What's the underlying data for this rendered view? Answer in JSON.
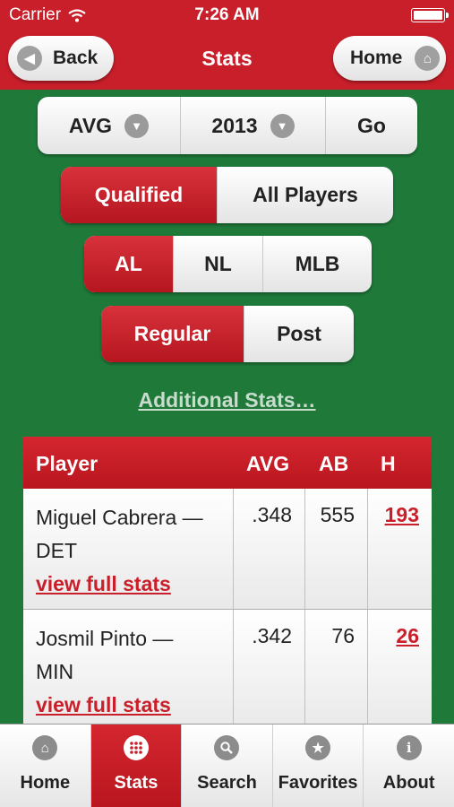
{
  "status_bar": {
    "carrier": "Carrier",
    "time": "7:26 AM"
  },
  "nav": {
    "title": "Stats",
    "back_label": "Back",
    "home_label": "Home"
  },
  "filters": {
    "stat_select": "AVG",
    "year_select": "2013",
    "go_label": "Go",
    "pool": [
      "Qualified",
      "All Players"
    ],
    "league": [
      "AL",
      "NL",
      "MLB"
    ],
    "season": [
      "Regular",
      "Post"
    ],
    "additional_stats": "Additional Stats…"
  },
  "table": {
    "headers": [
      "Player",
      "AVG",
      "AB",
      "H"
    ],
    "rows": [
      {
        "name_line1": "Miguel Cabrera —",
        "name_line2": "DET",
        "link": "view full stats",
        "avg": ".348",
        "ab": "555",
        "h": "193"
      },
      {
        "name_line1": "Josmil Pinto —",
        "name_line2": "MIN",
        "link": "view full stats",
        "avg": ".342",
        "ab": "76",
        "h": "26"
      }
    ]
  },
  "tabs": [
    "Home",
    "Stats",
    "Search",
    "Favorites",
    "About"
  ],
  "colors": {
    "brand_red": "#c81f2a",
    "field_green": "#1f7a3a"
  },
  "icons": [
    "wifi-icon",
    "battery-icon",
    "back-arrow-icon",
    "home-icon",
    "chevron-down-icon",
    "grid-icon",
    "search-icon",
    "star-icon",
    "info-icon"
  ]
}
